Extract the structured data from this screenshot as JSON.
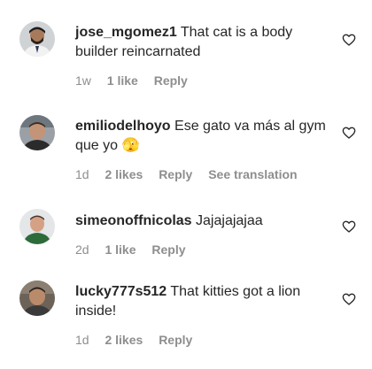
{
  "comments": [
    {
      "username": "jose_mgomez1",
      "text": "That cat is a body builder reincarnated",
      "time": "1w",
      "likes": "1 like",
      "reply": "Reply",
      "translate": ""
    },
    {
      "username": "emiliodelhoyo",
      "text": "Ese gato va más al gym que yo 🫣",
      "time": "1d",
      "likes": "2 likes",
      "reply": "Reply",
      "translate": "See translation"
    },
    {
      "username": "simeonoffnicolas",
      "text": "Jajajajajaa",
      "time": "2d",
      "likes": "1 like",
      "reply": "Reply",
      "translate": ""
    },
    {
      "username": "lucky777s512",
      "text": "That kitties got a lion inside!",
      "time": "1d",
      "likes": "2 likes",
      "reply": "Reply",
      "translate": ""
    }
  ],
  "icons": {
    "like": "heart-outline-icon"
  }
}
